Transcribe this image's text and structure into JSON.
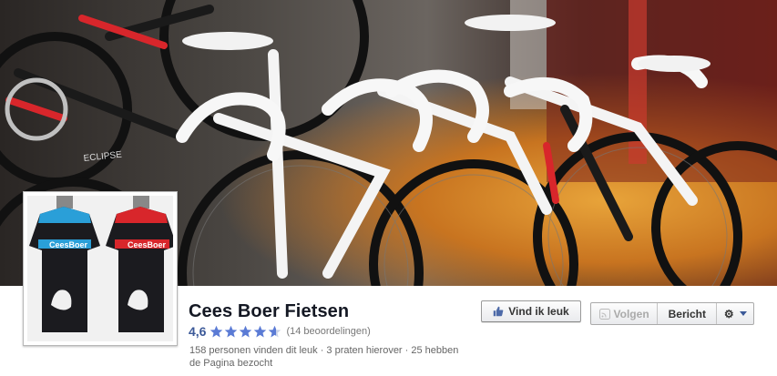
{
  "page": {
    "name": "Cees Boer Fietsen",
    "rating_value": "4,6",
    "rating_stars": 4.6,
    "rating_count": "(14 beoordelingen)",
    "stats": "158 personen vinden dit leuk · 3 praten hierover · 25 hebben de Pagina bezocht"
  },
  "cover": {
    "description_icon": "bicycles-photo",
    "brand_texts": [
      "ECLIPSE",
      "CeesBoer"
    ]
  },
  "profile": {
    "jersey_text": "CeesBoer",
    "icon": "cycling-jersey"
  },
  "actions": {
    "like_label": "Vind ik leuk",
    "follow_label": "Volgen",
    "message_label": "Bericht",
    "settings_icon": "gear-icon"
  },
  "colors": {
    "accent": "#3b5998",
    "star": "#5b7bd5",
    "jersey_blue": "#2a9fd8",
    "jersey_red": "#d8262b"
  }
}
